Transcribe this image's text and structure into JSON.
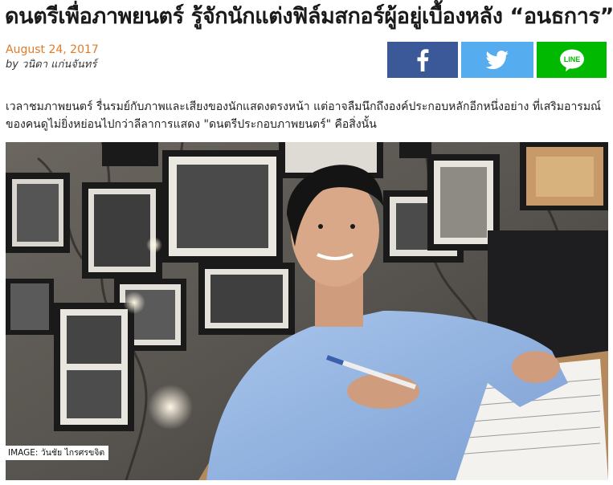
{
  "article": {
    "headline": "ดนตรีเพื่อภาพยนตร์ รู้จักนักแต่งฟิล์มสกอร์ผู้อยู่เบื้องหลัง “อนธการ”",
    "date": "August 24, 2017",
    "byline_prefix": "by",
    "author": "วนิดา แก่นจันทร์",
    "lead_paragraph": "เวลาชมภาพยนตร์ รื่นรมย์กับภาพและเสียงของนักแสดงตรงหน้า แต่อาจลืมนึกถึงองค์ประกอบหลักอีกหนึ่งอย่าง ที่เสริมอารมณ์ของคนดูไม่ยิ่งหย่อนไปกว่าลีลาการแสดง \"ดนตรีประกอบภาพยนตร์\" คือสิ่งนั้น"
  },
  "share": {
    "facebook_icon": "facebook-icon",
    "twitter_icon": "twitter-icon",
    "line_icon": "line-icon",
    "line_label": "LINE",
    "colors": {
      "facebook": "#3b5998",
      "twitter": "#55acee",
      "line": "#00b900"
    }
  },
  "photo": {
    "caption": "IMAGE: วันชัย ไกรศรขจิต"
  },
  "colors": {
    "date": "#e07b2a",
    "headline": "#1a1a1a"
  }
}
